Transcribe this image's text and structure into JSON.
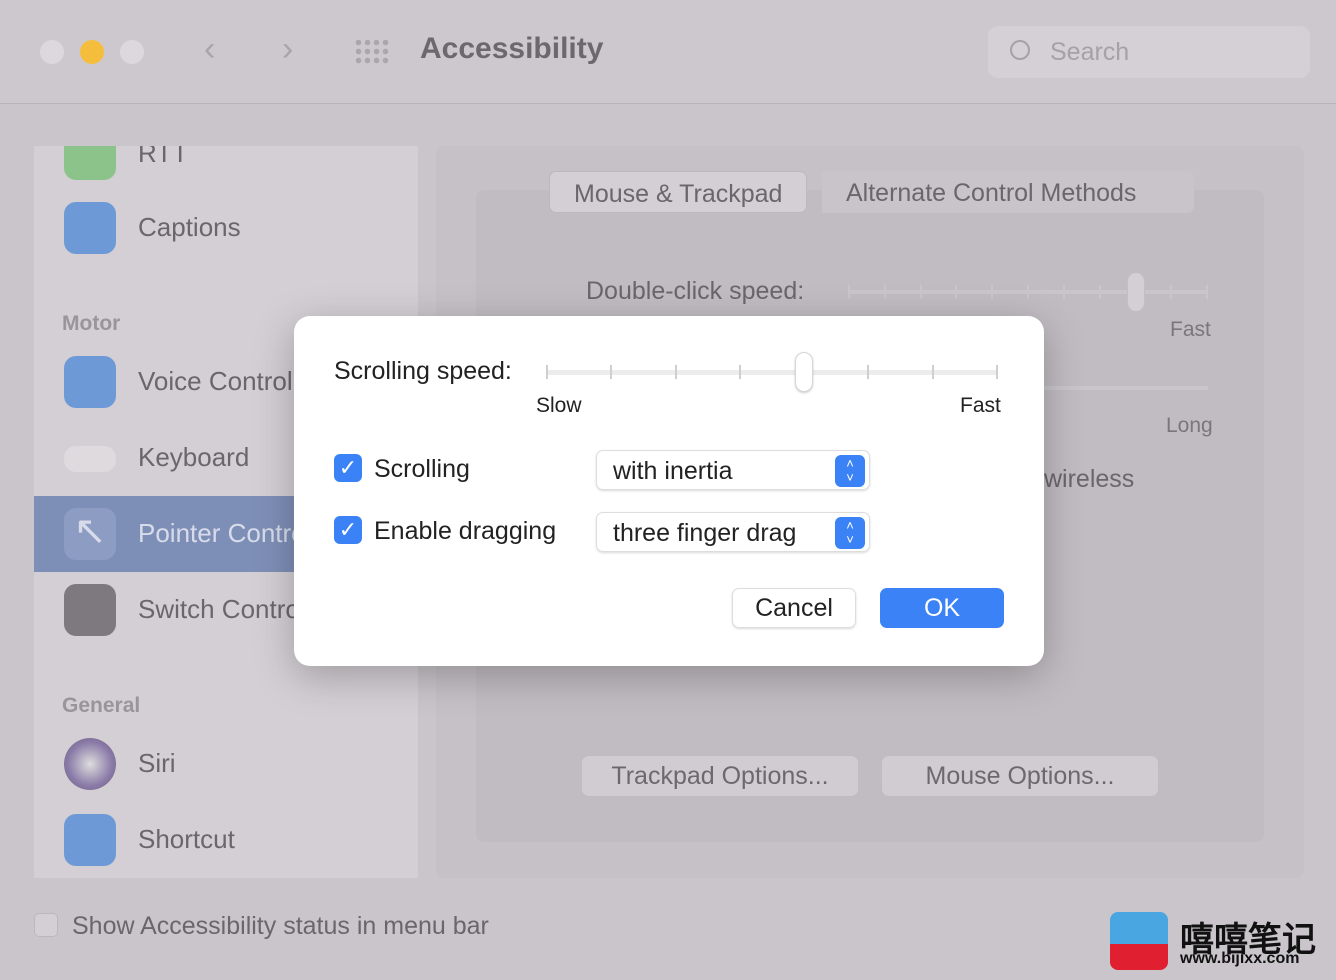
{
  "window": {
    "title": "Accessibility",
    "search_placeholder": "Search"
  },
  "sidebar": {
    "items": [
      {
        "label": "RTT",
        "color": "#8cc38a"
      },
      {
        "label": "Captions",
        "color": "#6d9ad6"
      },
      {
        "label": "Voice Control",
        "color": "#6d9ad6"
      },
      {
        "label": "Keyboard",
        "color": "#c4c0c5"
      },
      {
        "label": "Pointer Control",
        "color": "#7e8fb7"
      },
      {
        "label": "Switch Control",
        "color": "#7d797f"
      },
      {
        "label": "Siri",
        "color": "#8a7aa8"
      },
      {
        "label": "Shortcut",
        "color": "#6d9ad6"
      }
    ],
    "sections": {
      "motor": "Motor",
      "general": "General"
    },
    "selected": "Pointer Control"
  },
  "tabs": [
    {
      "label": "Mouse & Trackpad",
      "selected": true
    },
    {
      "label": "Alternate Control Methods",
      "selected": false
    }
  ],
  "background": {
    "double_click_label": "Double-click speed:",
    "double_click_value": 0.8,
    "fast": "Fast",
    "long": "Long",
    "wireless": "wireless",
    "trackpad_options": "Trackpad Options...",
    "mouse_options": "Mouse Options..."
  },
  "footer": {
    "status_checkbox_label": "Show Accessibility status in menu bar",
    "checked": false
  },
  "dialog": {
    "scrolling_speed_label": "Scrolling speed:",
    "scrolling_speed_value": 0.57,
    "slow": "Slow",
    "fast": "Fast",
    "scrolling": {
      "label": "Scrolling",
      "checked": true,
      "value": "with inertia"
    },
    "dragging": {
      "label": "Enable dragging",
      "checked": true,
      "value": "three finger drag"
    },
    "cancel": "Cancel",
    "ok": "OK"
  },
  "watermark": {
    "text": "嘻嘻笔记",
    "url": "www.bijixx.com"
  },
  "colors": {
    "accent": "#3a82f6",
    "yellow": "#f5bd3c"
  }
}
